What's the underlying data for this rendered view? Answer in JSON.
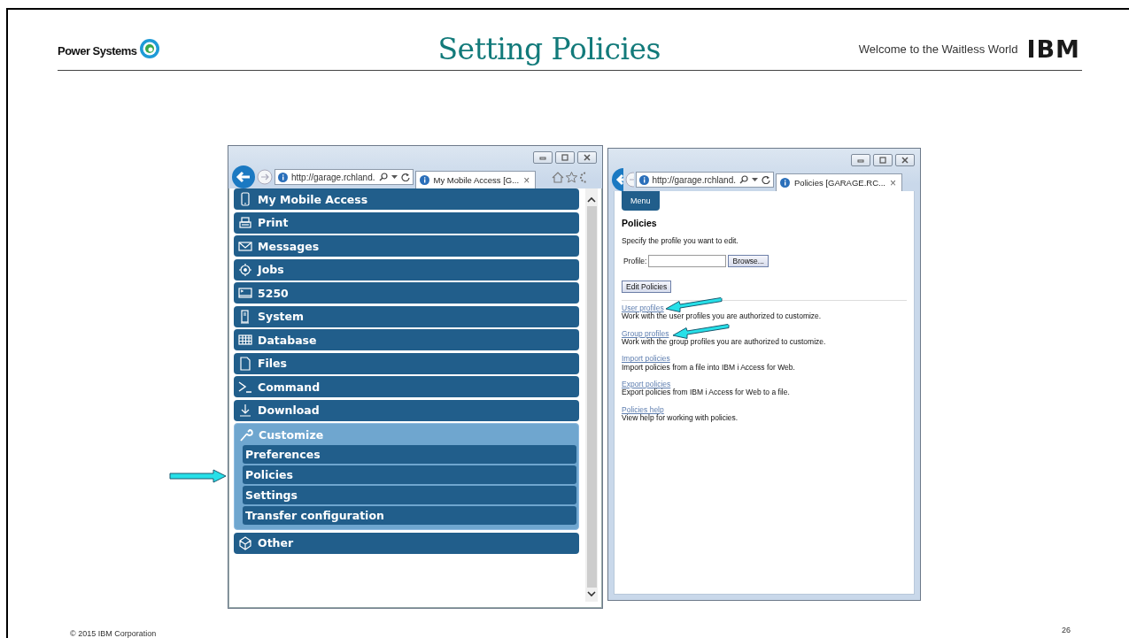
{
  "slide": {
    "brand": "Power Systems",
    "title": "Setting Policies",
    "tagline": "Welcome to the Waitless World",
    "logo": "IBM",
    "footer": "© 2015 IBM Corporation",
    "page_number": "26"
  },
  "left_window": {
    "address": "http://garage.rchland.",
    "tab_title": "My Mobile Access [G...",
    "tab_close": "×",
    "menu": [
      {
        "label": "My Mobile Access",
        "expanded": false
      },
      {
        "label": "Print",
        "expanded": false
      },
      {
        "label": "Messages",
        "expanded": false
      },
      {
        "label": "Jobs",
        "expanded": false
      },
      {
        "label": "5250",
        "expanded": false
      },
      {
        "label": "System",
        "expanded": false
      },
      {
        "label": "Database",
        "expanded": false
      },
      {
        "label": "Files",
        "expanded": false
      },
      {
        "label": "Command",
        "expanded": false
      },
      {
        "label": "Download",
        "expanded": false
      },
      {
        "label": "Customize",
        "expanded": true,
        "children": [
          {
            "label": "Preferences"
          },
          {
            "label": "Policies"
          },
          {
            "label": "Settings"
          },
          {
            "label": "Transfer configuration"
          }
        ]
      },
      {
        "label": "Other",
        "expanded": false
      }
    ]
  },
  "right_window": {
    "address": "http://garage.rchland.",
    "tab_title": "Policies [GARAGE.RC...",
    "tab_close": "×",
    "menu_button": "Menu",
    "heading": "Policies",
    "instruction": "Specify the profile you want to edit.",
    "profile_label": "Profile:",
    "browse_button": "Browse...",
    "edit_button": "Edit Policies",
    "links": [
      {
        "link": "User profiles",
        "description": "Work with the user profiles you are authorized to customize."
      },
      {
        "link": "Group profiles",
        "description": "Work with the group profiles you are authorized to customize."
      },
      {
        "link": "Import policies",
        "description": "Import policies from a file into IBM i Access for Web."
      },
      {
        "link": "Export policies",
        "description": "Export policies from IBM i Access for Web to a file."
      },
      {
        "link": "Policies help",
        "description": "View help for working with policies."
      }
    ]
  }
}
